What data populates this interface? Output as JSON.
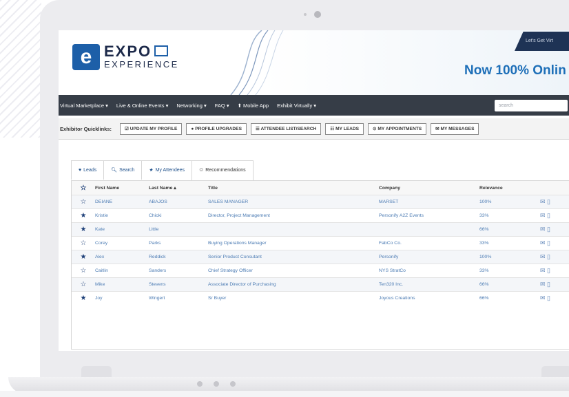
{
  "header": {
    "logo_badge": "e",
    "logo_name": "EXPO",
    "logo_sub": "EXPERIENCE",
    "tagline": "Now 100% Onlin",
    "banner": "Let's Get Virt"
  },
  "nav": {
    "items": [
      "Virtual Marketplace ▾",
      "Live & Online Events ▾",
      "Networking ▾",
      "FAQ ▾",
      "⬆ Mobile App",
      "Exhibit Virtually ▾"
    ],
    "search_placeholder": "search"
  },
  "quicklinks": {
    "label": "Exhibitor Quicklinks:",
    "buttons": [
      "☑ UPDATE MY PROFILE",
      "● PROFILE UPGRADES",
      "☰ ATTENDEE LIST/SEARCH",
      "☷ MY LEADS",
      "⊙ MY APPOINTMENTS",
      "✉ MY MESSAGES"
    ]
  },
  "tabs": [
    {
      "icon": "♥",
      "label": "Leads"
    },
    {
      "icon": "🔍︎",
      "label": "Search"
    },
    {
      "icon": "★",
      "label": "My Attendees"
    },
    {
      "icon": "♲",
      "label": "Recommendations"
    }
  ],
  "table": {
    "columns": [
      "First Name",
      "Last Name ▴",
      "Title",
      "Company",
      "Relevance"
    ],
    "rows": [
      {
        "starred": false,
        "first": "DEIANE",
        "last": "ABAJOS",
        "title": "SALES MANAGER",
        "company": "MARSET",
        "relevance": "100%"
      },
      {
        "starred": true,
        "first": "Kristie",
        "last": "Chicki",
        "title": "Director, Project Management",
        "company": "Personify A2Z Events",
        "relevance": "33%"
      },
      {
        "starred": true,
        "first": "Kate",
        "last": "Little",
        "title": "",
        "company": "",
        "relevance": "66%"
      },
      {
        "starred": false,
        "first": "Corey",
        "last": "Parks",
        "title": "Buying Operations Manager",
        "company": "FabCo Co.",
        "relevance": "33%"
      },
      {
        "starred": true,
        "first": "Alex",
        "last": "Reddick",
        "title": "Senior Product Consutant",
        "company": "Personify",
        "relevance": "100%"
      },
      {
        "starred": false,
        "first": "Caitlin",
        "last": "Sanders",
        "title": "Chief Strategy Officer",
        "company": "NYS StratCo",
        "relevance": "33%"
      },
      {
        "starred": false,
        "first": "Mike",
        "last": "Stevens",
        "title": "Associate Director of Purchasing",
        "company": "Ten320 Inc.",
        "relevance": "66%"
      },
      {
        "starred": true,
        "first": "Joy",
        "last": "Wingert",
        "title": "Sr Buyer",
        "company": "Joyous Creations",
        "relevance": "66%"
      }
    ]
  }
}
